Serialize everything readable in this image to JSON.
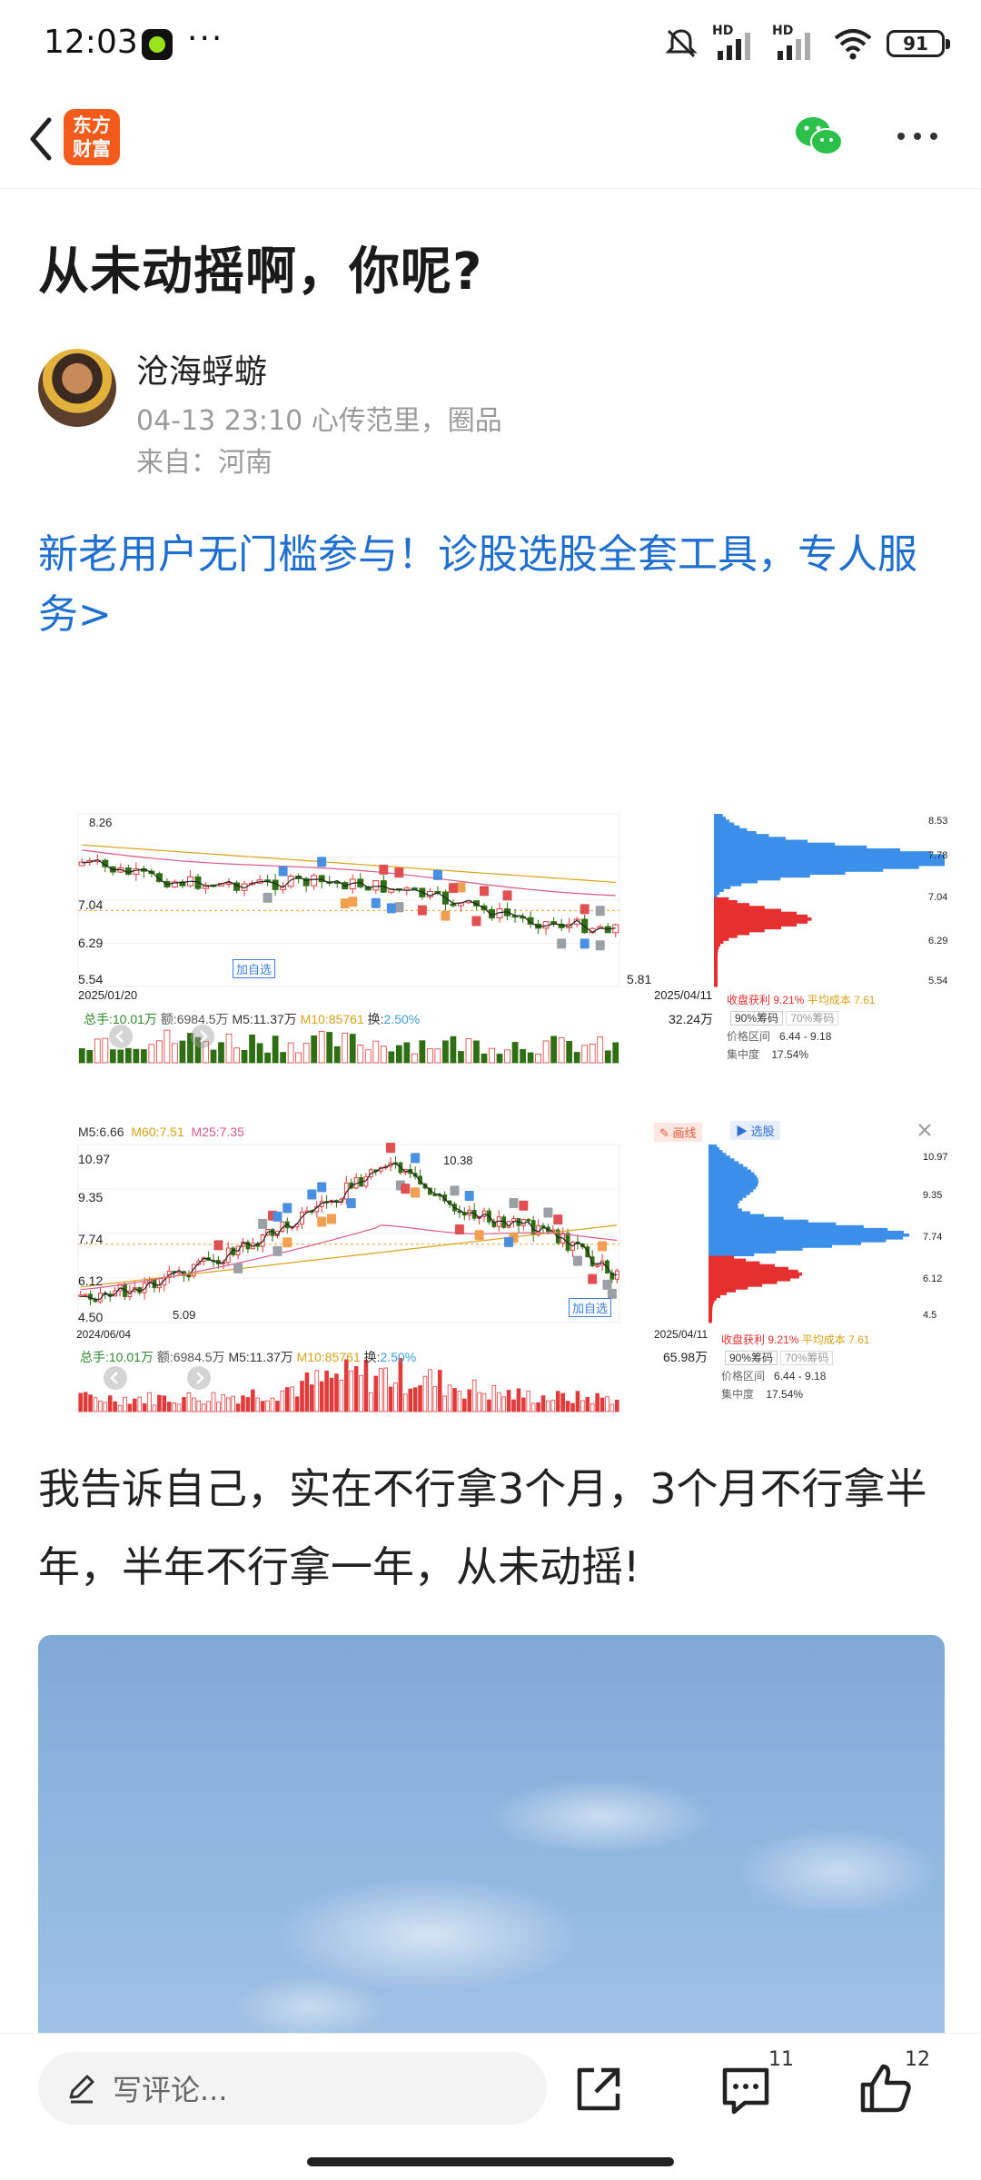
{
  "status_bar": {
    "time": "12:03",
    "more": "···",
    "battery": "91",
    "signal1": "HD",
    "signal2": "HD"
  },
  "header": {
    "logo_line1": "东方",
    "logo_line2": "财富"
  },
  "post": {
    "title": "从未动摇啊，你呢?",
    "author": "沧海蜉蝣",
    "meta": "04-13 23:10  心传范里，圈品",
    "from": "来自：河南",
    "promo": "新老用户无门槛参与！诊股选股全套工具，专人服务>",
    "body": "我告诉自己，实在不行拿3个月，3个月不行拿半年，半年不行拿一年，从未动摇!"
  },
  "chart1": {
    "start_date": "2025/01/20",
    "end_date": "2025/04/11",
    "max_label": "8.26",
    "min_label": "5.81",
    "yticks": [
      "7.04",
      "6.29",
      "5.54"
    ],
    "right_ticks": [
      "8.53",
      "7.78",
      "7.04",
      "6.29",
      "5.54"
    ],
    "add_label": "加自选",
    "vol_info": {
      "total": "总手:10.01万",
      "amount": "额:6984.5万",
      "m5": "M5:11.37万",
      "m10": "M10:85761",
      "turnover_label": "换:",
      "turnover": "2.50%"
    },
    "vol_max": "32.24万",
    "cost": {
      "profit_label": "收盘获利",
      "profit": "9.21%",
      "avg_label": "平均成本",
      "avg": "7.61",
      "chip90": "90%筹码",
      "chip70": "70%筹码",
      "range_label": "价格区间",
      "range": "6.44 - 9.18",
      "conc_label": "集中度",
      "conc": "17.54%"
    }
  },
  "chart2": {
    "ma_m5": "M5:6.66",
    "ma_m60": "M60:7.51",
    "ma_m25": "M25:7.35",
    "draw_btn": "画线",
    "select_btn": "选股",
    "start_date": "2024/06/04",
    "end_date": "2025/04/11",
    "max_label": "10.38",
    "min_label": "5.09",
    "yticks": [
      "10.97",
      "9.35",
      "7.74",
      "6.12",
      "4.50"
    ],
    "right_ticks": [
      "10.97",
      "9.35",
      "7.74",
      "6.12",
      "4.5"
    ],
    "add_label": "加自选",
    "vol_info": {
      "total": "总手:10.01万",
      "amount": "额:6984.5万",
      "m5": "M5:11.37万",
      "m10": "M10:85761",
      "turnover_label": "换:",
      "turnover": "2.50%"
    },
    "vol_max": "65.98万",
    "cost": {
      "profit_label": "收盘获利",
      "profit": "9.21%",
      "avg_label": "平均成本",
      "avg": "7.61",
      "chip90": "90%筹码",
      "chip70": "70%筹码",
      "range_label": "价格区间",
      "range": "6.44 - 9.18",
      "conc_label": "集中度",
      "conc": "17.54%"
    }
  },
  "bottom": {
    "placeholder": "写评论...",
    "comment_count": "11",
    "like_count": "12"
  },
  "colors": {
    "up": "#e03a3a",
    "down": "#2f6e12",
    "link": "#1f6fd1",
    "chip_blue": "#3b8fe8",
    "chip_red": "#e63030"
  }
}
